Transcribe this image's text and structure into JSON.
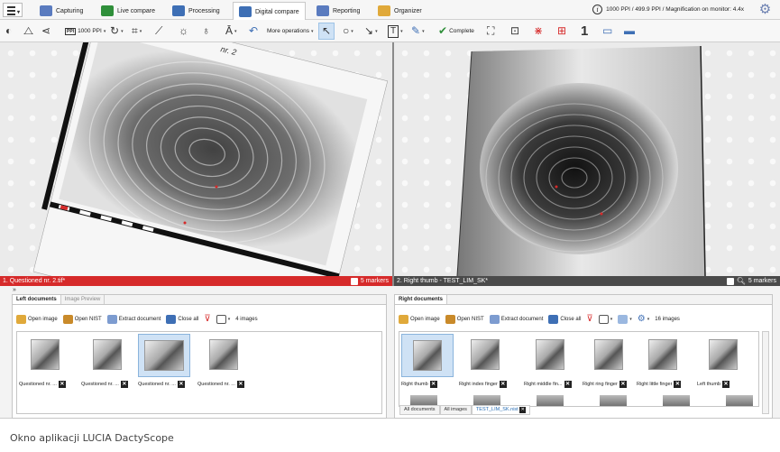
{
  "tabs": [
    {
      "label": "Capturing",
      "icon": "capturing-icon",
      "color": "#5a7bbf"
    },
    {
      "label": "Live compare",
      "icon": "live-compare-icon",
      "color": "#2f8f3a"
    },
    {
      "label": "Processing",
      "icon": "processing-icon",
      "color": "#3e6fb5"
    },
    {
      "label": "Digital compare",
      "icon": "digital-compare-icon",
      "color": "#3e6fb5",
      "active": true
    },
    {
      "label": "Reporting",
      "icon": "reporting-icon",
      "color": "#5a7bbf"
    },
    {
      "label": "Organizer",
      "icon": "organizer-icon",
      "color": "#e0a93a"
    }
  ],
  "monitor_info": "1000 PPI / 499.9 PPI / Magnification on monitor: 4.4x",
  "toolbar": {
    "ppi_label": "1000 PPI",
    "more_operations": "More operations",
    "complete": "Complete",
    "number": "1"
  },
  "left_viewer": {
    "label": "1. Questioned nr. 2.tif*",
    "markers": "5 markers",
    "overlay_text": "nr. 2"
  },
  "right_viewer": {
    "label": "2. Right thumb - TEST_LIM_SK*",
    "markers": "5 markers"
  },
  "left_panel": {
    "tabs": [
      "Left documents",
      "Image Preview"
    ],
    "buttons": {
      "open_image": "Open image",
      "open_nist": "Open NIST",
      "extract": "Extract document",
      "close_all": "Close all"
    },
    "count": "4 images",
    "items": [
      "Questioned nr. ...",
      "Questioned nr. ...",
      "Questioned nr. ...",
      "Questioned nr. ..."
    ]
  },
  "right_panel": {
    "tabs": [
      "Right documents"
    ],
    "buttons": {
      "open_image": "Open image",
      "open_nist": "Open NIST",
      "extract": "Extract document",
      "close_all": "Close all"
    },
    "count": "16 images",
    "items": [
      "Right thumb",
      "Right index finger",
      "Right middle fin...",
      "Right ring finger",
      "Right little finger",
      "Left thumb"
    ],
    "bottom_tabs": [
      "All documents",
      "All images",
      "TEST_LIM_SK.nist"
    ]
  },
  "colors": {
    "accent_red": "#d62a2a",
    "selection": "#cfe2f5",
    "gear": "#6a7fb0"
  },
  "caption": "Okno aplikacji LUCIA DactyScope"
}
